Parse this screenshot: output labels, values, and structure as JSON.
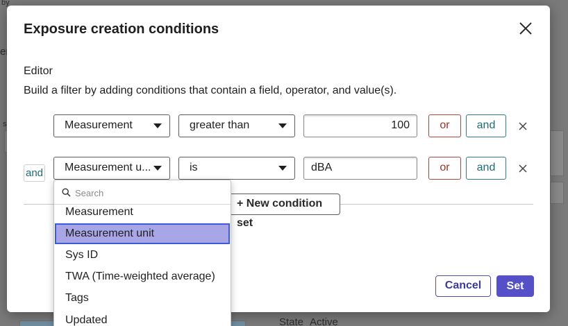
{
  "background": {
    "fragments": [
      "by",
      "er",
      "s",
      "State",
      "Active"
    ]
  },
  "modal": {
    "title": "Exposure creation conditions",
    "close_icon": "close-icon",
    "editor_label": "Editor",
    "editor_description": "Build a filter by adding conditions that contain a field, operator, and value(s).",
    "rows": [
      {
        "prefix": "",
        "field": "Measurement",
        "operator": "greater than",
        "value": "100",
        "value_align": "right",
        "or_label": "or",
        "and_label": "and"
      },
      {
        "prefix": "and",
        "field": "Measurement u...",
        "operator": "is",
        "value": "dBA",
        "value_align": "left",
        "or_label": "or",
        "and_label": "and"
      }
    ],
    "new_condition_set_label": "+ New condition set",
    "cancel_label": "Cancel",
    "set_label": "Set"
  },
  "dropdown": {
    "search_placeholder": "Search",
    "search_icon": "search-icon",
    "items": [
      {
        "label": "Measurement",
        "selected": false
      },
      {
        "label": "Measurement unit",
        "selected": true
      },
      {
        "label": "Sys ID",
        "selected": false
      },
      {
        "label": "TWA (Time-weighted average)",
        "selected": false
      },
      {
        "label": "Tags",
        "selected": false
      },
      {
        "label": "Updated",
        "selected": false
      }
    ]
  },
  "colors": {
    "primary": "#5550c8",
    "or_color": "#9e3129",
    "and_color": "#1d6b74",
    "selected_bg": "#a8a6e6",
    "selected_border": "#3d5ad8"
  }
}
